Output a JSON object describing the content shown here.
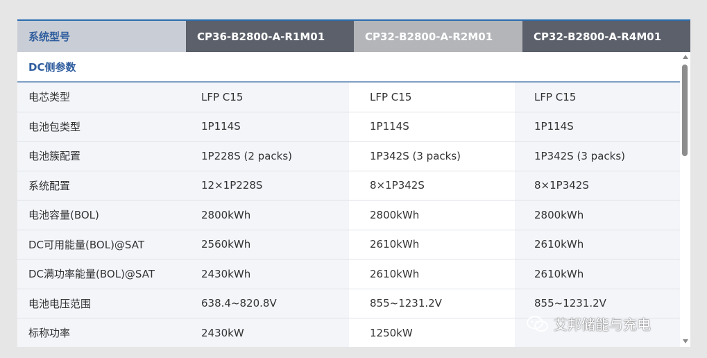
{
  "header": {
    "label": "系统型号",
    "models": [
      "CP36-B2800-A-R1M01",
      "CP32-B2800-A-R2M01",
      "CP32-B2800-A-R4M01"
    ]
  },
  "section": {
    "title": "DC侧参数"
  },
  "rows": [
    {
      "label": "电芯类型",
      "values": [
        "LFP C15",
        "LFP C15",
        "LFP C15"
      ]
    },
    {
      "label": "电池包类型",
      "values": [
        "1P114S",
        "1P114S",
        "1P114S"
      ]
    },
    {
      "label": "电池簇配置",
      "values": [
        "1P228S (2 packs)",
        "1P342S (3 packs)",
        "1P342S (3 packs)"
      ]
    },
    {
      "label": "系统配置",
      "values": [
        "12×1P228S",
        "8×1P342S",
        "8×1P342S"
      ]
    },
    {
      "label": "电池容量(BOL)",
      "values": [
        "2800kWh",
        "2800kWh",
        "2800kWh"
      ]
    },
    {
      "label": "DC可用能量(BOL)@SAT",
      "values": [
        "2560kWh",
        "2610kWh",
        "2610kWh"
      ]
    },
    {
      "label": "DC满功率能量(BOL)@SAT",
      "values": [
        "2430kWh",
        "2610kWh",
        "2610kWh"
      ]
    },
    {
      "label": "电池电压范围",
      "values": [
        "638.4~820.8V",
        "855~1231.2V",
        "855~1231.2V"
      ]
    },
    {
      "label": "标称功率",
      "values": [
        "2430kW",
        "1250kW",
        ""
      ]
    }
  ],
  "watermark": {
    "text": "艾邦储能与充电",
    "icon": "wechat-chat-icon"
  },
  "colors": {
    "accent": "#2f5d9e",
    "header_dark": "#5b606a",
    "header_light": "#b3b5b9",
    "header_label_bg": "#c9ced6",
    "row_bg": "#f3f5f9"
  }
}
